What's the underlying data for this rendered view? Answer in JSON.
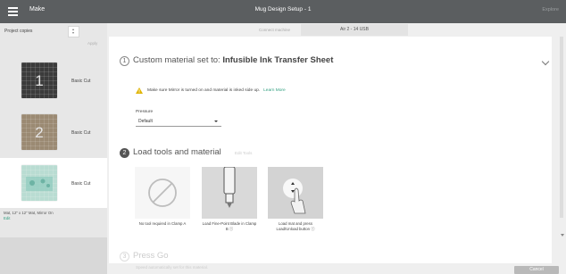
{
  "header": {
    "app_name": "Make",
    "title": "Mug Design Setup - 1",
    "explore": "Explore"
  },
  "sidebar": {
    "copies_label": "Project copies",
    "copies_value": "",
    "apply_label": "Apply",
    "mats": [
      {
        "number": "1",
        "label": "Basic Cut",
        "color": "#3b3b3b"
      },
      {
        "number": "2",
        "label": "Basic Cut",
        "color": "#9b8a73"
      },
      {
        "number": "",
        "label": "Basic Cut",
        "color": "#b9dcd2"
      }
    ],
    "mat_info": "Mat, 12\" x 12\" Mat, Mirror On",
    "edit_label": "Edit"
  },
  "machine": {
    "label": "Connect machine",
    "value": "Air 2 - 14 USB"
  },
  "step1": {
    "number": "1",
    "prefix": "Custom material set to:",
    "material": "Infusible Ink Transfer Sheet",
    "warning": "Make sure Mirror is turned on and material is inked side up.",
    "learn_more": "Learn More",
    "pressure_label": "Pressure",
    "pressure_value": "Default"
  },
  "step2": {
    "number": "2",
    "title": "Load tools and material",
    "edit_tools": "Edit Tools",
    "tools": [
      {
        "caption": "No tool required in Clamp A",
        "icon": "no-tool-icon"
      },
      {
        "caption": "Load Fine-Point Blade in Clamp B ⓘ",
        "icon": "fine-point-blade-icon"
      },
      {
        "caption": "Load mat and press Load/Unload button ⓘ",
        "icon": "load-unload-button-icon"
      }
    ]
  },
  "step3": {
    "number": "3",
    "title": "Press Go",
    "subtitle": "Speed automatically set for this material."
  },
  "footer": {
    "cancel_label": "Cancel"
  },
  "colors": {
    "topbar": "#5b5e60",
    "accent": "#2f9e7f",
    "warning": "#e0b400"
  }
}
